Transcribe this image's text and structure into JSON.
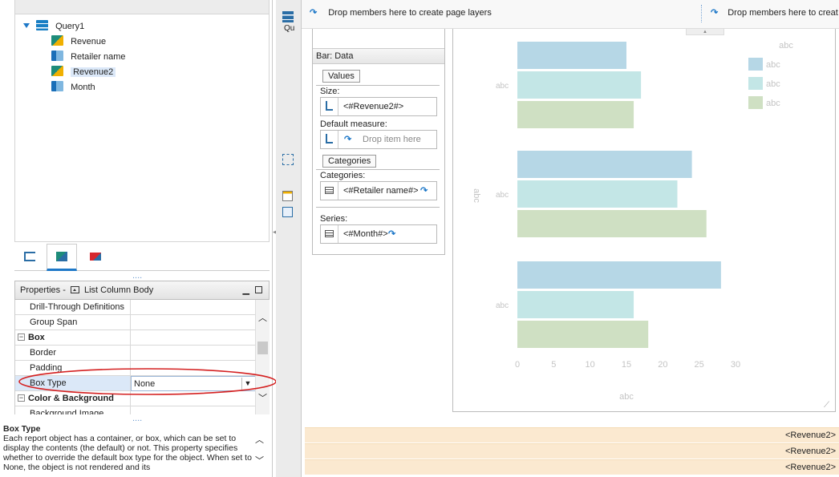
{
  "tree": {
    "root": "Query1",
    "items": [
      {
        "label": "Revenue",
        "icon": "measure-icon",
        "selected": false
      },
      {
        "label": "Retailer name",
        "icon": "dimension-icon",
        "selected": false
      },
      {
        "label": "Revenue2",
        "icon": "measure-icon",
        "selected": true
      },
      {
        "label": "Month",
        "icon": "dimension-icon",
        "selected": false
      }
    ]
  },
  "dots": "....",
  "properties": {
    "title": "Properties -",
    "object": "List Column Body",
    "rows": [
      {
        "name": "Drill-Through Definitions",
        "value": "",
        "group": false
      },
      {
        "name": "Group Span",
        "value": "",
        "group": false
      },
      {
        "name": "Box",
        "value": "",
        "group": true
      },
      {
        "name": "Border",
        "value": "",
        "group": false
      },
      {
        "name": "Padding",
        "value": "",
        "group": false
      },
      {
        "name": "Box Type",
        "value": "None",
        "group": false,
        "selected": true
      },
      {
        "name": "Color & Background",
        "value": "",
        "group": true
      },
      {
        "name": "Background Image",
        "value": "",
        "group": false
      }
    ]
  },
  "description": {
    "title": "Box Type",
    "text": "Each report object has a container, or box, which can be set to display the contents (the default) or not. This property specifies whether to override the default box type for the object. When set to None, the object is not rendered and its"
  },
  "mid_strip": {
    "label": "Qu"
  },
  "top_bar": {
    "page_layers": "Drop members here to create page layers",
    "context": "Drop members here to creat"
  },
  "bar_panel": {
    "title": "Bar: Data",
    "values_label": "Values",
    "size_label": "Size:",
    "size_value": "<#Revenue2#>",
    "default_measure_label": "Default measure:",
    "default_measure_placeholder": "Drop item here",
    "categories_section": "Categories",
    "categories_label": "Categories:",
    "categories_value": "<#Retailer name#>",
    "series_label": "Series:",
    "series_value": "<#Month#>"
  },
  "chart_data": {
    "type": "bar",
    "orientation": "horizontal",
    "title": "abc",
    "xlabel": "abc",
    "ylabel": "abc",
    "categories": [
      "abc",
      "abc",
      "abc"
    ],
    "xlim": [
      0,
      30
    ],
    "xticks": [
      "0",
      "5",
      "10",
      "15",
      "20",
      "25",
      "30"
    ],
    "series": [
      {
        "name": "abc",
        "color": "#b6d7e6",
        "values": [
          15,
          24,
          28
        ]
      },
      {
        "name": "abc",
        "color": "#c3e6e6",
        "values": [
          17,
          22,
          16
        ]
      },
      {
        "name": "abc",
        "color": "#cfe0c3",
        "values": [
          16,
          26,
          18
        ]
      }
    ],
    "legend": "top-right"
  },
  "bottom_rows": [
    "<Revenue2>",
    "<Revenue2>",
    "<Revenue2>"
  ]
}
